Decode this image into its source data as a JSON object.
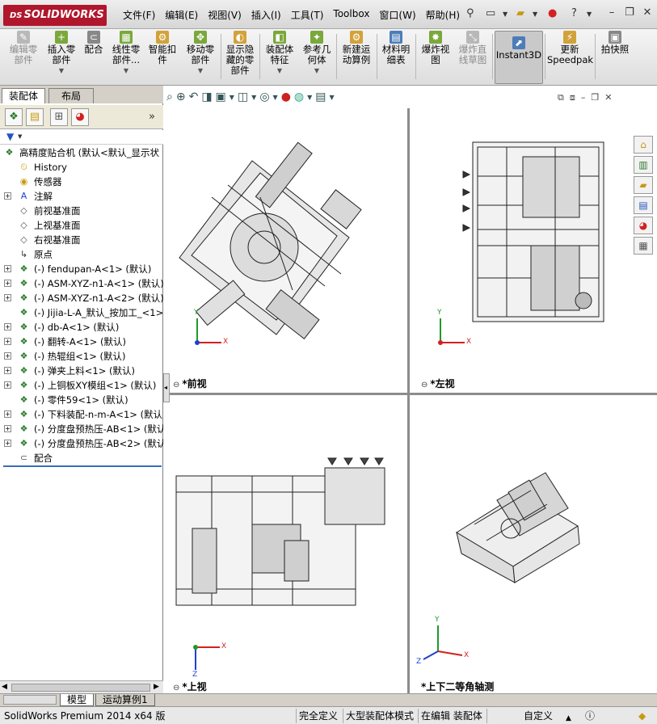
{
  "titlebar": {
    "logo_prefix": "DS",
    "logo_text": "SOLIDWORKS",
    "menus": [
      "文件(F)",
      "编辑(E)",
      "视图(V)",
      "插入(I)",
      "工具(T)",
      "Toolbox",
      "窗口(W)",
      "帮助(H)"
    ]
  },
  "ribbon": {
    "buttons": [
      {
        "label": "编辑零\n部件",
        "disabled": true
      },
      {
        "label": "插入零\n部件"
      },
      {
        "label": "配合"
      },
      {
        "label": "线性零\n部件..."
      },
      {
        "label": "智能扣\n件"
      },
      {
        "label": "移动零\n部件"
      },
      {
        "label": "显示隐\n藏的零\n部件"
      },
      {
        "label": "装配体\n特征"
      },
      {
        "label": "参考几\n何体"
      },
      {
        "label": "新建运\n动算例"
      },
      {
        "label": "材料明\n细表"
      },
      {
        "label": "爆炸视\n图"
      },
      {
        "label": "爆炸直\n线草图",
        "disabled": true
      },
      {
        "label": "Instant3D",
        "active": true
      },
      {
        "label": "更新\nSpeedpak"
      },
      {
        "label": "拍快照"
      }
    ]
  },
  "leftpanel": {
    "tabs": [
      "装配体",
      "布局"
    ],
    "tree_root": "高精度贴合机  (默认<默认_显示状",
    "tree": [
      {
        "label": "History",
        "icon": "history-icon",
        "exp": false
      },
      {
        "label": "传感器",
        "icon": "sensor-icon",
        "exp": false
      },
      {
        "label": "注解",
        "icon": "annotation-icon",
        "exp": true
      },
      {
        "label": "前视基准面",
        "icon": "plane-icon",
        "exp": false
      },
      {
        "label": "上视基准面",
        "icon": "plane-icon",
        "exp": false
      },
      {
        "label": "右视基准面",
        "icon": "plane-icon",
        "exp": false
      },
      {
        "label": "原点",
        "icon": "origin-icon",
        "exp": false
      },
      {
        "label": "(-) fendupan-A<1> (默认)",
        "icon": "subassembly-icon",
        "exp": true
      },
      {
        "label": "(-) ASM-XYZ-n1-A<1> (默认)",
        "icon": "subassembly-icon",
        "exp": true
      },
      {
        "label": "(-) ASM-XYZ-n1-A<2> (默认)",
        "icon": "subassembly-icon",
        "exp": true
      },
      {
        "label": "(-) Jijia-L-A_默认_按加工_<1>",
        "icon": "subassembly-icon",
        "exp": false
      },
      {
        "label": "(-) db-A<1> (默认)",
        "icon": "subassembly-icon",
        "exp": true
      },
      {
        "label": "(-) 翻转-A<1> (默认)",
        "icon": "subassembly-icon",
        "exp": true
      },
      {
        "label": "(-) 热辊组<1> (默认)",
        "icon": "subassembly-icon",
        "exp": true
      },
      {
        "label": "(-) 弹夹上料<1> (默认)",
        "icon": "subassembly-icon",
        "exp": true
      },
      {
        "label": "(-) 上铜板XY模组<1> (默认)",
        "icon": "subassembly-icon",
        "exp": true
      },
      {
        "label": "(-) 零件59<1> (默认)",
        "icon": "subassembly-icon",
        "exp": false
      },
      {
        "label": "(-) 下料装配-n-m-A<1> (默认)",
        "icon": "subassembly-icon",
        "exp": true
      },
      {
        "label": "(-) 分度盘预热压-AB<1> (默认",
        "icon": "subassembly-icon",
        "exp": true
      },
      {
        "label": "(-) 分度盘预热压-AB<2> (默认",
        "icon": "subassembly-icon",
        "exp": true
      },
      {
        "label": "配合",
        "icon": "mates-icon",
        "exp": false
      }
    ]
  },
  "viewports": {
    "front": "*前视",
    "left": "*左视",
    "top": "*上视",
    "iso": "*上下二等角轴测",
    "axis_x": "X",
    "axis_y": "Y",
    "axis_z": "Z"
  },
  "bottomtabs": [
    "模型",
    "运动算例1"
  ],
  "status": {
    "product": "SolidWorks Premium 2014 x64 版",
    "defined": "完全定义",
    "mode": "大型装配体模式",
    "editing": "在编辑 装配体",
    "custom": "自定义"
  },
  "colors": {
    "brand": "#b0162c",
    "axis_x": "#d22020",
    "axis_y": "#1f9a2a",
    "axis_z": "#1f3fcf"
  }
}
